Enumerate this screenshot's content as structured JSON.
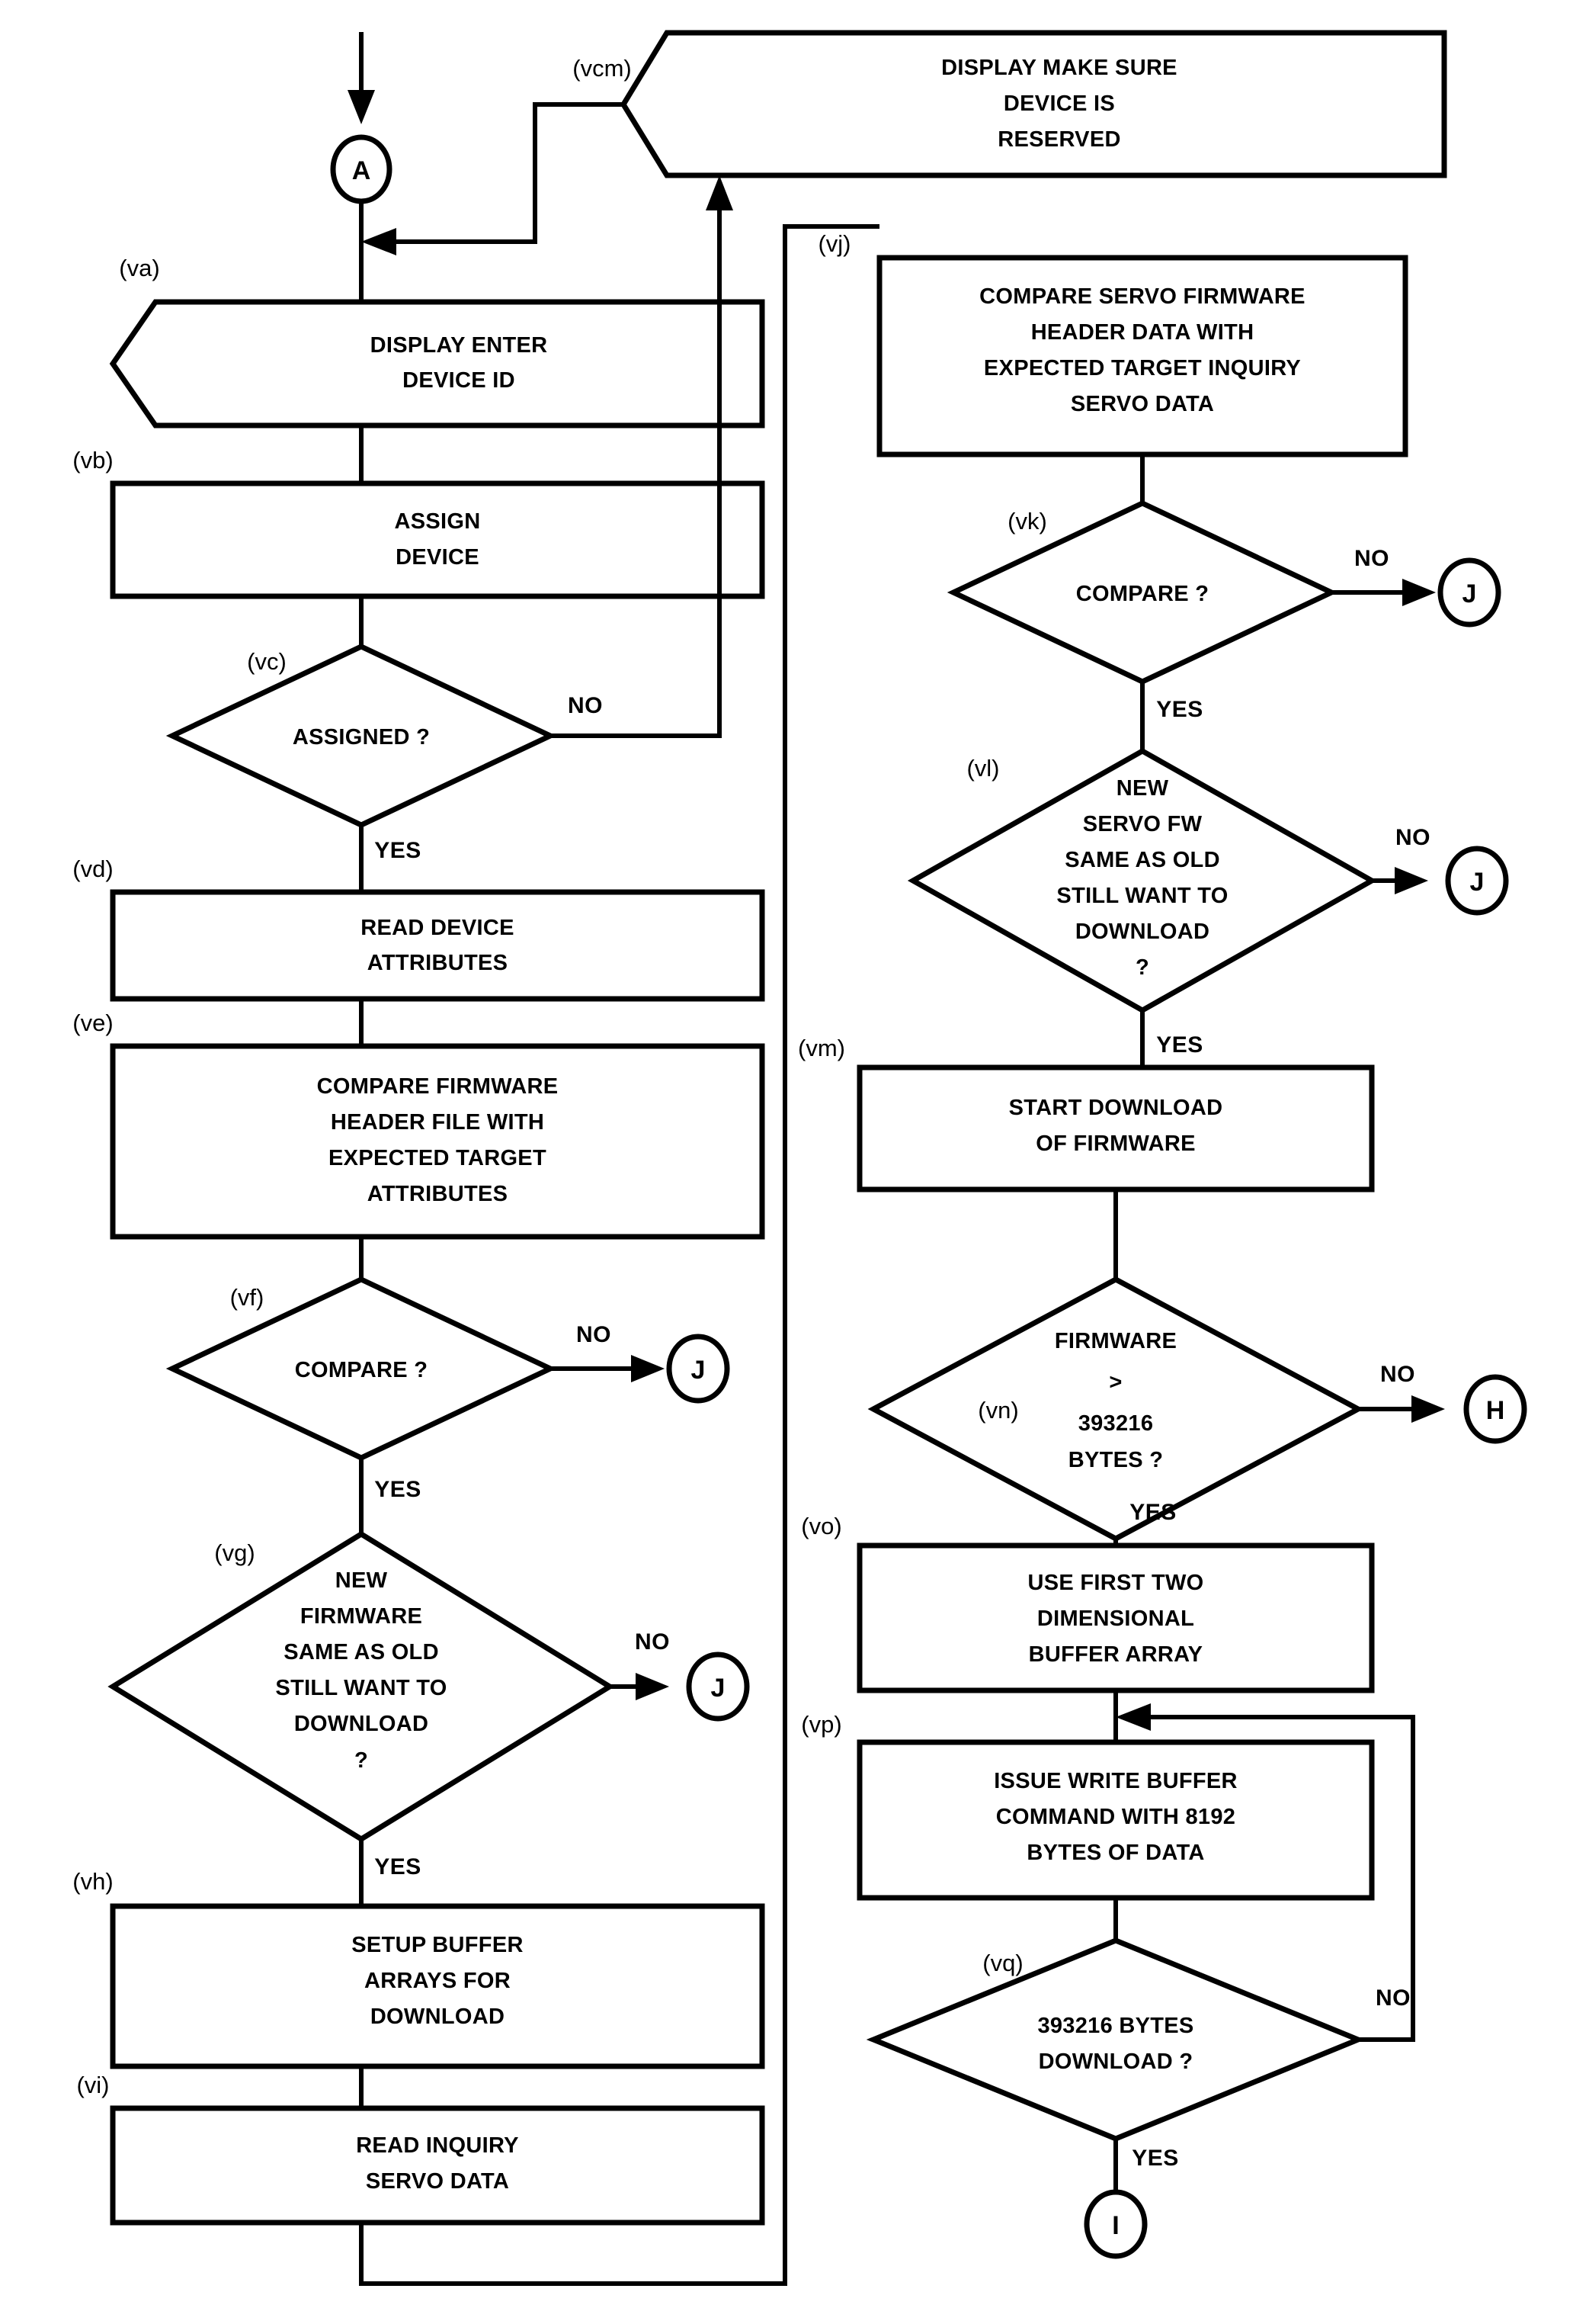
{
  "diagram": {
    "type": "flowchart",
    "title": "Firmware Download Flowchart",
    "branch_labels": {
      "yes": "YES",
      "no": "NO"
    },
    "nodes": [
      {
        "id": "A",
        "ref": "",
        "shape": "connector",
        "label": "A",
        "lines": [
          "A"
        ]
      },
      {
        "id": "vcm",
        "ref": "(vcm)",
        "shape": "display",
        "lines": [
          "DISPLAY MAKE SURE",
          "DEVICE IS",
          "RESERVED"
        ]
      },
      {
        "id": "va",
        "ref": "(va)",
        "shape": "display",
        "lines": [
          "DISPLAY ENTER",
          "DEVICE ID"
        ]
      },
      {
        "id": "vb",
        "ref": "(vb)",
        "shape": "process",
        "lines": [
          "ASSIGN",
          "DEVICE"
        ]
      },
      {
        "id": "vc",
        "ref": "(vc)",
        "shape": "decision",
        "lines": [
          "ASSIGNED ?"
        ],
        "yes": "YES",
        "no": "NO"
      },
      {
        "id": "vd",
        "ref": "(vd)",
        "shape": "process",
        "lines": [
          "READ DEVICE",
          "ATTRIBUTES"
        ]
      },
      {
        "id": "ve",
        "ref": "(ve)",
        "shape": "process",
        "lines": [
          "COMPARE FIRMWARE",
          "HEADER FILE WITH",
          "EXPECTED TARGET",
          "ATTRIBUTES"
        ]
      },
      {
        "id": "vf",
        "ref": "(vf)",
        "shape": "decision",
        "lines": [
          "COMPARE ?"
        ],
        "yes": "YES",
        "no": "NO"
      },
      {
        "id": "vg",
        "ref": "(vg)",
        "shape": "decision",
        "lines": [
          "NEW",
          "FIRMWARE",
          "SAME AS OLD",
          "STILL WANT TO",
          "DOWNLOAD",
          "?"
        ],
        "yes": "YES",
        "no": "NO"
      },
      {
        "id": "vh",
        "ref": "(vh)",
        "shape": "process",
        "lines": [
          "SETUP BUFFER",
          "ARRAYS FOR",
          "DOWNLOAD"
        ]
      },
      {
        "id": "vi",
        "ref": "(vi)",
        "shape": "process",
        "lines": [
          "READ INQUIRY",
          "SERVO DATA"
        ]
      },
      {
        "id": "vj",
        "ref": "(vj)",
        "shape": "process",
        "lines": [
          "COMPARE SERVO FIRMWARE",
          "HEADER  DATA WITH",
          "EXPECTED TARGET INQUIRY",
          "SERVO DATA"
        ]
      },
      {
        "id": "vk",
        "ref": "(vk)",
        "shape": "decision",
        "lines": [
          "COMPARE ?"
        ],
        "yes": "YES",
        "no": "NO"
      },
      {
        "id": "vl",
        "ref": "(vl)",
        "shape": "decision",
        "lines": [
          "NEW",
          "SERVO FW",
          "SAME AS OLD",
          "STILL WANT TO",
          "DOWNLOAD",
          "?"
        ],
        "yes": "YES",
        "no": "NO"
      },
      {
        "id": "vm",
        "ref": "(vm)",
        "shape": "process",
        "lines": [
          "START DOWNLOAD",
          "OF FIRMWARE"
        ]
      },
      {
        "id": "vn",
        "ref": "(vn)",
        "shape": "decision",
        "lines": [
          "FIRMWARE",
          ">",
          "393216",
          "BYTES ?"
        ],
        "yes": "YES",
        "no": "NO"
      },
      {
        "id": "vo",
        "ref": "(vo)",
        "shape": "process",
        "lines": [
          "USE FIRST TWO",
          "DIMENSIONAL",
          "BUFFER ARRAY"
        ]
      },
      {
        "id": "vp",
        "ref": "(vp)",
        "shape": "process",
        "lines": [
          "ISSUE WRITE BUFFER",
          "COMMAND WITH 8192",
          "BYTES OF DATA"
        ]
      },
      {
        "id": "vq",
        "ref": "(vq)",
        "shape": "decision",
        "lines": [
          "393216 BYTES",
          "DOWNLOAD ?"
        ],
        "yes": "YES",
        "no": "NO"
      }
    ],
    "connectors": [
      {
        "id": "conn-a",
        "label": "A"
      },
      {
        "id": "conn-j1",
        "label": "J"
      },
      {
        "id": "conn-j2",
        "label": "J"
      },
      {
        "id": "conn-j3",
        "label": "J"
      },
      {
        "id": "conn-j4",
        "label": "J"
      },
      {
        "id": "conn-h",
        "label": "H"
      },
      {
        "id": "conn-i",
        "label": "I"
      }
    ],
    "text": {
      "vcm_l1": "DISPLAY MAKE SURE",
      "vcm_l2": "DEVICE IS",
      "vcm_l3": "RESERVED",
      "va_l1": "DISPLAY ENTER",
      "va_l2": "DEVICE ID",
      "vb_l1": "ASSIGN",
      "vb_l2": "DEVICE",
      "vc_l1": "ASSIGNED ?",
      "vd_l1": "READ DEVICE",
      "vd_l2": "ATTRIBUTES",
      "ve_l1": "COMPARE FIRMWARE",
      "ve_l2": "HEADER FILE WITH",
      "ve_l3": "EXPECTED TARGET",
      "ve_l4": "ATTRIBUTES",
      "vf_l1": "COMPARE ?",
      "vg_l1": "NEW",
      "vg_l2": "FIRMWARE",
      "vg_l3": "SAME AS OLD",
      "vg_l4": "STILL WANT TO",
      "vg_l5": "DOWNLOAD",
      "vg_l6": "?",
      "vh_l1": "SETUP BUFFER",
      "vh_l2": "ARRAYS FOR",
      "vh_l3": "DOWNLOAD",
      "vi_l1": "READ INQUIRY",
      "vi_l2": "SERVO DATA",
      "vj_l1": "COMPARE SERVO FIRMWARE",
      "vj_l2": "HEADER  DATA WITH",
      "vj_l3": "EXPECTED TARGET INQUIRY",
      "vj_l4": "SERVO DATA",
      "vk_l1": "COMPARE ?",
      "vl_l1": "NEW",
      "vl_l2": "SERVO FW",
      "vl_l3": "SAME AS OLD",
      "vl_l4": "STILL WANT TO",
      "vl_l5": "DOWNLOAD",
      "vl_l6": "?",
      "vm_l1": "START DOWNLOAD",
      "vm_l2": "OF FIRMWARE",
      "vn_l1": "FIRMWARE",
      "vn_l2": ">",
      "vn_l3": "393216",
      "vn_l4": "BYTES ?",
      "vo_l1": "USE FIRST TWO",
      "vo_l2": "DIMENSIONAL",
      "vo_l3": "BUFFER ARRAY",
      "vp_l1": "ISSUE WRITE BUFFER",
      "vp_l2": "COMMAND WITH 8192",
      "vp_l3": "BYTES OF DATA",
      "vq_l1": "393216 BYTES",
      "vq_l2": "DOWNLOAD ?"
    },
    "refs": {
      "vcm": "(vcm)",
      "va": "(va)",
      "vb": "(vb)",
      "vc": "(vc)",
      "vd": "(vd)",
      "ve": "(ve)",
      "vf": "(vf)",
      "vg": "(vg)",
      "vh": "(vh)",
      "vi": "(vi)",
      "vj": "(vj)",
      "vk": "(vk)",
      "vl": "(vl)",
      "vm": "(vm)",
      "vn": "(vn)",
      "vo": "(vo)",
      "vp": "(vp)",
      "vq": "(vq)"
    },
    "branches": {
      "vc_no": "NO",
      "vc_yes": "YES",
      "vf_no": "NO",
      "vf_yes": "YES",
      "vg_no": "NO",
      "vg_yes": "YES",
      "vk_no": "NO",
      "vk_yes": "YES",
      "vl_no": "NO",
      "vl_yes": "YES",
      "vn_no": "NO",
      "vn_yes": "YES",
      "vq_no": "NO",
      "vq_yes": "YES"
    },
    "connector_labels": {
      "a": "A",
      "j_vf": "J",
      "j_vg": "J",
      "j_vk": "J",
      "j_vl": "J",
      "h": "H",
      "i": "I"
    },
    "colors": {
      "stroke": "#000000",
      "fill": "#ffffff",
      "background": "#ffffff"
    }
  }
}
